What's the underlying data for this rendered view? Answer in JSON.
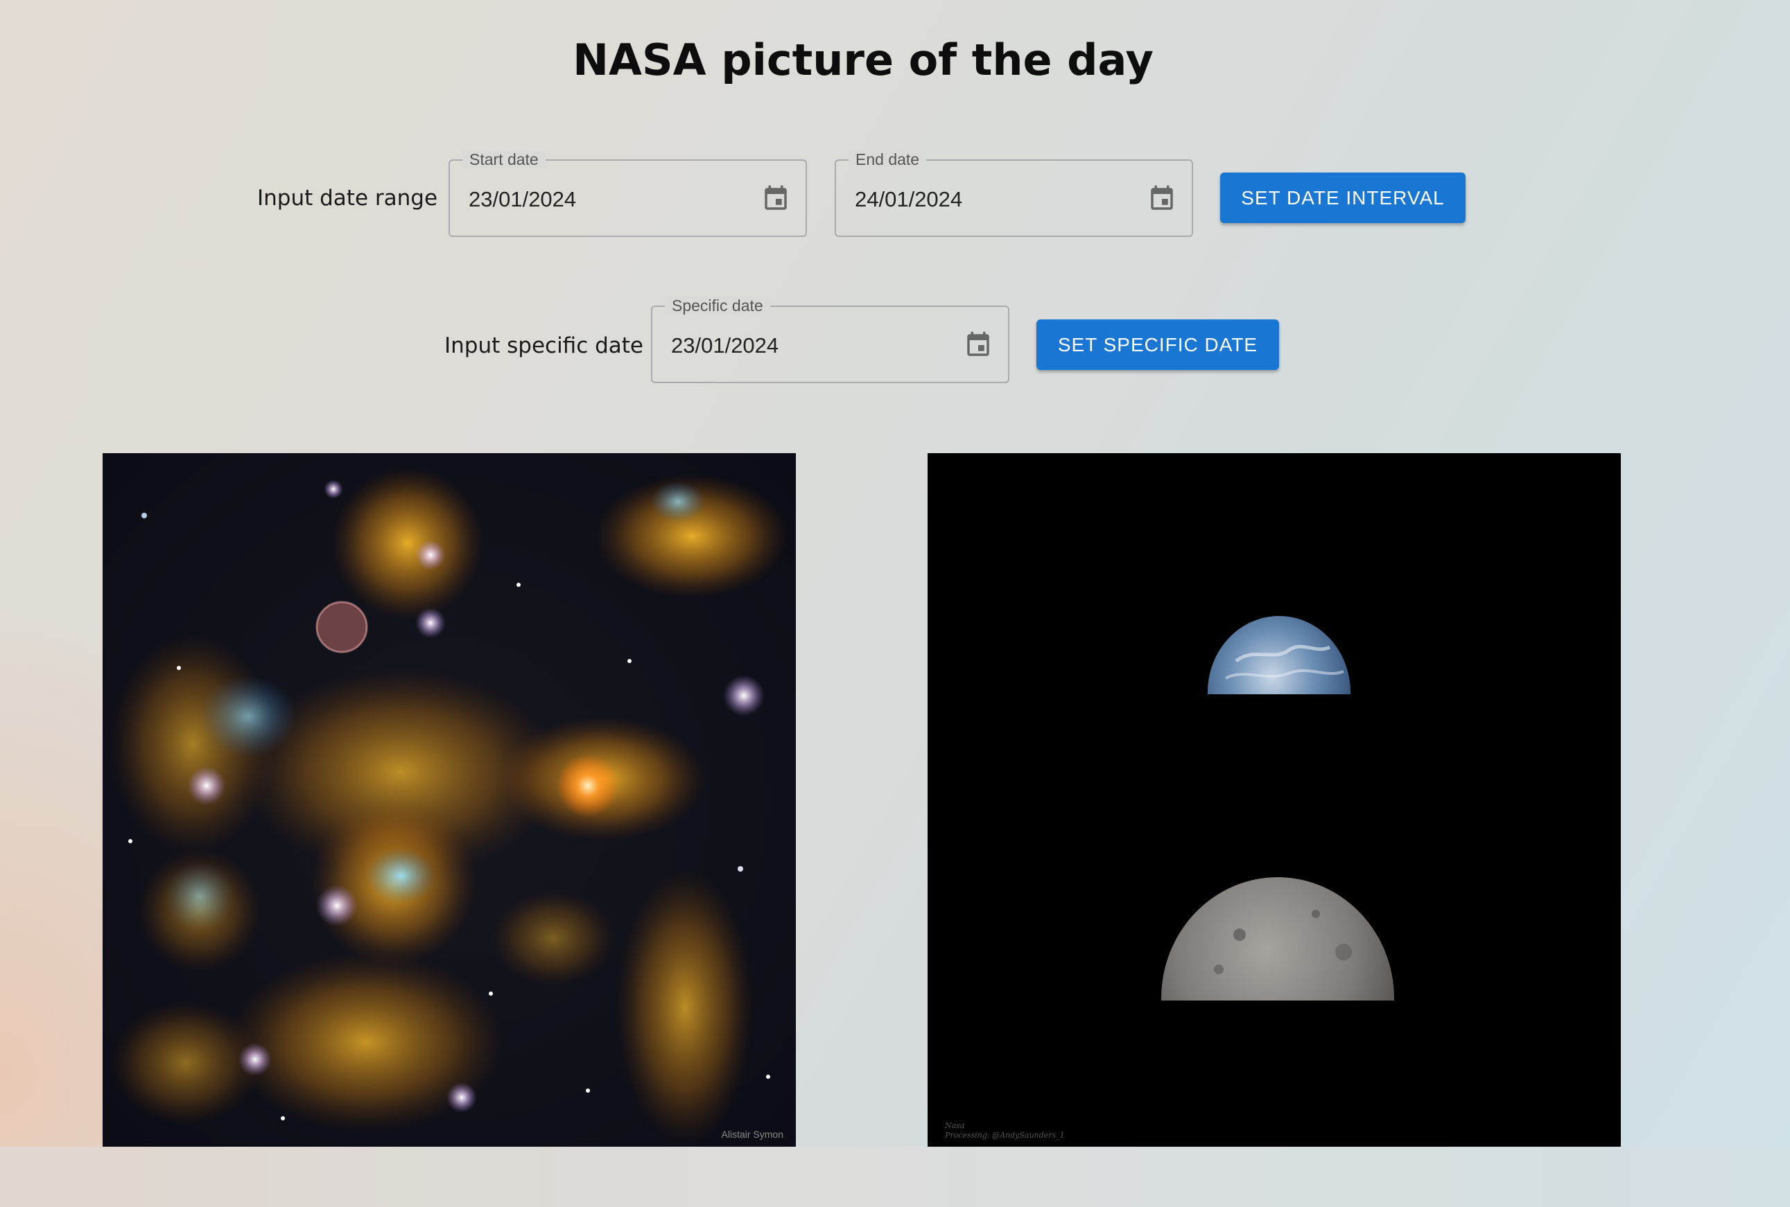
{
  "header": {
    "title": "NASA picture of the day"
  },
  "date_range": {
    "label": "Input date range",
    "start": {
      "legend": "Start date",
      "value": "23/01/2024",
      "icon": "calendar-icon"
    },
    "end": {
      "legend": "End date",
      "value": "24/01/2024",
      "icon": "calendar-icon"
    },
    "button_label": "SET DATE INTERVAL"
  },
  "specific": {
    "label": "Input specific date",
    "field": {
      "legend": "Specific date",
      "value": "23/01/2024",
      "icon": "calendar-icon"
    },
    "button_label": "SET SPECIFIC DATE"
  },
  "gallery": {
    "images": [
      {
        "subject": "nebula",
        "credit": "Alistair Symon"
      },
      {
        "subject": "earth-and-moon",
        "credit_lines": [
          "Nasa",
          "Processing: @AndySaunders_1"
        ]
      }
    ]
  },
  "colors": {
    "accent": "#1976d2",
    "border": "#a9abad",
    "text": "#1a1a1a"
  }
}
